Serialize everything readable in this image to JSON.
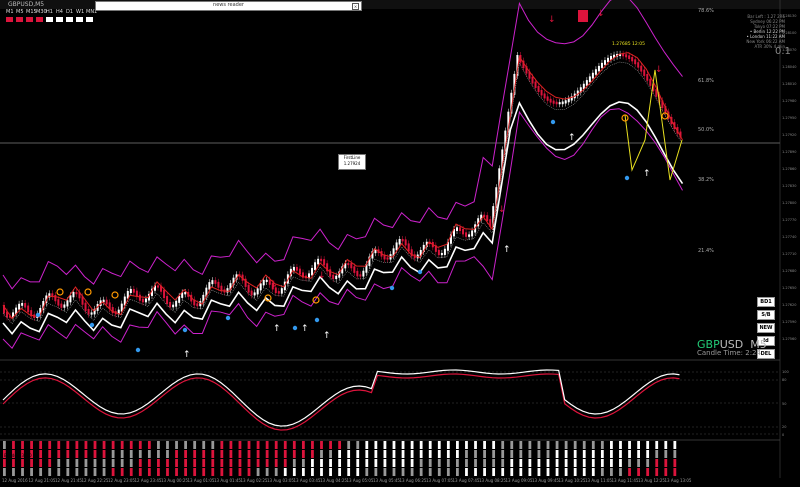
{
  "window": {
    "title": "GBPUSD,M5"
  },
  "timeframes": [
    "M1",
    "M5",
    "M15",
    "M30",
    "H1",
    "H4",
    "D1",
    "W1",
    "MN1"
  ],
  "news": {
    "label": "news reader"
  },
  "symbol": {
    "pair_a": "GBP",
    "pair_b": "USD",
    "timeframe": "M5",
    "candle_time": "Candle Time: 2:24"
  },
  "first_line": {
    "label": "FirstLine",
    "value": "1.27924"
  },
  "levels": [
    "78.6%",
    "61.8%",
    "50.0%",
    "38.2%",
    "21.4%"
  ],
  "price_tag": "1.27685 12:05",
  "info_panel": [
    "Bar Left : 1.27 2R6",
    "Sydney 06:22 PM",
    "Tokyo 07:22 PM",
    "• Berlin 12:22 PM",
    "• London 11:22 AM",
    "New York 06:22 AM",
    "ATR 30% 4 min"
  ],
  "right_buttons": [
    "BD1",
    "S/B",
    "NEW",
    "Id",
    "DEL"
  ],
  "big_value": "0.1",
  "price_axis": [
    "1.28130",
    "1.28100",
    "1.28070",
    "1.28040",
    "1.28010",
    "1.27980",
    "1.27950",
    "1.27920",
    "1.27890",
    "1.27860",
    "1.27830",
    "1.27800",
    "1.27770",
    "1.27740",
    "1.27710",
    "1.27680",
    "1.27650",
    "1.27620",
    "1.27590",
    "1.27560"
  ],
  "osc_axis": [
    "100",
    "80",
    "50",
    "20",
    "0"
  ],
  "heat_label": "Bands 1.3000",
  "x_axis": [
    "12 Aug 2016",
    "12 Aug 21:05",
    "12 Aug 21:45",
    "12 Aug 22:25",
    "12 Aug 23:05",
    "12 Aug 23:45",
    "13 Aug 00:25",
    "13 Aug 01:05",
    "13 Aug 01:45",
    "13 Aug 02:25",
    "13 Aug 03:05",
    "13 Aug 03:45",
    "13 Aug 04:25",
    "13 Aug 05:05",
    "13 Aug 05:45",
    "13 Aug 06:25",
    "13 Aug 07:05",
    "13 Aug 07:45",
    "13 Aug 08:25",
    "13 Aug 09:05",
    "13 Aug 09:45",
    "13 Aug 10:25",
    "13 Aug 11:05",
    "13 Aug 11:45",
    "13 Aug 12:25",
    "13 Aug 13:05"
  ],
  "colors": {
    "bull": "#ffffff",
    "bear": "#dc143c",
    "band": "#cc22cc",
    "mid": "#dd2222",
    "yellow": "#e8e020",
    "blue": "#3399ee",
    "orange": "#ff9900"
  }
}
